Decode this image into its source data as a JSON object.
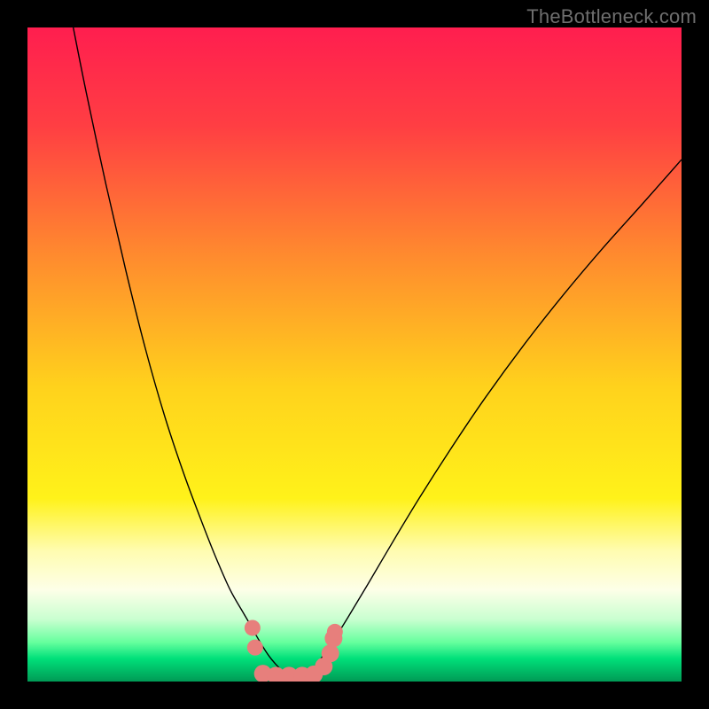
{
  "watermark": "TheBottleneck.com",
  "chart_data": {
    "type": "line",
    "title": "",
    "xlabel": "",
    "ylabel": "",
    "xlim": [
      0,
      100
    ],
    "ylim": [
      0,
      100
    ],
    "background_gradient": {
      "stops": [
        {
          "offset": 0,
          "color": "#ff1e4f"
        },
        {
          "offset": 0.15,
          "color": "#ff3e43"
        },
        {
          "offset": 0.35,
          "color": "#ff8b2e"
        },
        {
          "offset": 0.55,
          "color": "#ffd21c"
        },
        {
          "offset": 0.72,
          "color": "#fff21a"
        },
        {
          "offset": 0.8,
          "color": "#fffcb0"
        },
        {
          "offset": 0.86,
          "color": "#fdffe8"
        },
        {
          "offset": 0.905,
          "color": "#c9ffd0"
        },
        {
          "offset": 0.94,
          "color": "#66ff9e"
        },
        {
          "offset": 0.965,
          "color": "#00e07a"
        },
        {
          "offset": 1.0,
          "color": "#009a55"
        }
      ]
    },
    "series": [
      {
        "name": "left-curve",
        "color": "#000000",
        "width": 1.4,
        "points": [
          {
            "x": 7.0,
            "y": 100.0
          },
          {
            "x": 9.0,
            "y": 90.0
          },
          {
            "x": 12.0,
            "y": 76.0
          },
          {
            "x": 15.0,
            "y": 63.0
          },
          {
            "x": 18.0,
            "y": 51.0
          },
          {
            "x": 21.0,
            "y": 40.5
          },
          {
            "x": 24.0,
            "y": 31.5
          },
          {
            "x": 27.0,
            "y": 23.5
          },
          {
            "x": 29.0,
            "y": 18.5
          },
          {
            "x": 31.0,
            "y": 14.0
          },
          {
            "x": 33.0,
            "y": 10.5
          },
          {
            "x": 34.3,
            "y": 8.3
          },
          {
            "x": 35.0,
            "y": 7.0
          },
          {
            "x": 36.0,
            "y": 5.3
          },
          {
            "x": 37.0,
            "y": 3.8
          },
          {
            "x": 38.0,
            "y": 2.6
          },
          {
            "x": 39.0,
            "y": 1.6
          },
          {
            "x": 40.0,
            "y": 0.8
          }
        ]
      },
      {
        "name": "right-curve",
        "color": "#000000",
        "width": 1.4,
        "points": [
          {
            "x": 42.5,
            "y": 0.8
          },
          {
            "x": 43.5,
            "y": 1.8
          },
          {
            "x": 44.5,
            "y": 3.0
          },
          {
            "x": 45.5,
            "y": 4.4
          },
          {
            "x": 47.0,
            "y": 6.6
          },
          {
            "x": 49.0,
            "y": 9.8
          },
          {
            "x": 52.0,
            "y": 14.8
          },
          {
            "x": 56.0,
            "y": 21.6
          },
          {
            "x": 60.0,
            "y": 28.2
          },
          {
            "x": 65.0,
            "y": 36.0
          },
          {
            "x": 70.0,
            "y": 43.4
          },
          {
            "x": 76.0,
            "y": 51.6
          },
          {
            "x": 82.0,
            "y": 59.2
          },
          {
            "x": 88.0,
            "y": 66.3
          },
          {
            "x": 94.0,
            "y": 73.0
          },
          {
            "x": 100.0,
            "y": 79.8
          }
        ]
      }
    ],
    "markers": {
      "name": "highlight-markers",
      "color": "#e77f7c",
      "points": [
        {
          "x": 34.4,
          "y": 8.2,
          "r": 9
        },
        {
          "x": 34.8,
          "y": 5.2,
          "r": 9
        },
        {
          "x": 36.0,
          "y": 1.2,
          "r": 10
        },
        {
          "x": 38.0,
          "y": 0.9,
          "r": 10
        },
        {
          "x": 40.0,
          "y": 0.9,
          "r": 10
        },
        {
          "x": 42.0,
          "y": 0.9,
          "r": 10
        },
        {
          "x": 43.8,
          "y": 1.1,
          "r": 10
        },
        {
          "x": 45.3,
          "y": 2.3,
          "r": 10
        },
        {
          "x": 46.3,
          "y": 4.3,
          "r": 10
        },
        {
          "x": 46.8,
          "y": 6.6,
          "r": 10
        },
        {
          "x": 47.0,
          "y": 7.6,
          "r": 9
        }
      ]
    }
  }
}
